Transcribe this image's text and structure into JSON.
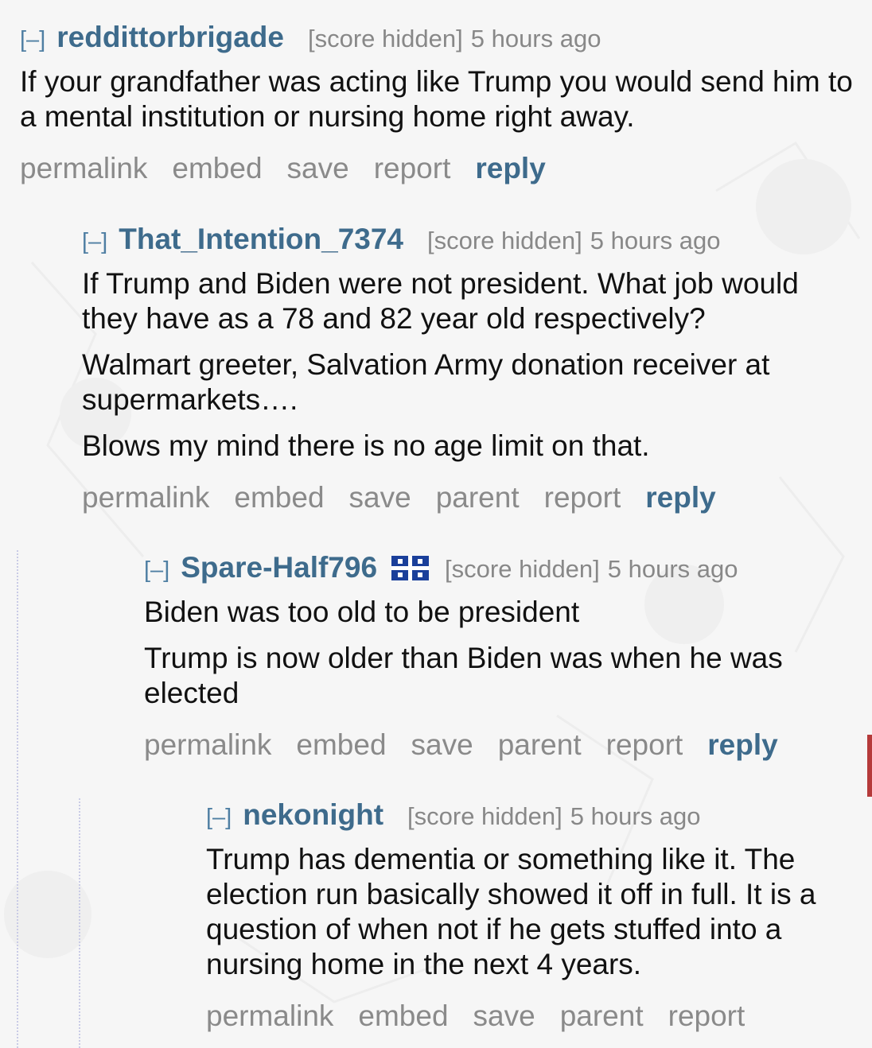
{
  "comments": [
    {
      "collapse": "[–]",
      "author": "reddittorbrigade",
      "score": "[score hidden]",
      "time": "5 hours ago",
      "paragraphs": [
        "If your grandfather was acting like Trump you would send him to a mental institution or nursing home right away."
      ],
      "buttons": {
        "permalink": "permalink",
        "embed": "embed",
        "save": "save",
        "report": "report",
        "reply": "reply"
      }
    },
    {
      "collapse": "[–]",
      "author": "That_Intention_7374",
      "score": "[score hidden]",
      "time": "5 hours ago",
      "paragraphs": [
        "If Trump and Biden were not president. What job would they have as a 78 and 82 year old respectively?",
        "Walmart greeter, Salvation Army donation receiver at supermarkets….",
        "Blows my mind there is no age limit on that."
      ],
      "buttons": {
        "permalink": "permalink",
        "embed": "embed",
        "save": "save",
        "parent": "parent",
        "report": "report",
        "reply": "reply"
      }
    },
    {
      "collapse": "[–]",
      "author": "Spare-Half796",
      "flair_icon": "quebec-flag-icon",
      "score": "[score hidden]",
      "time": "5 hours ago",
      "paragraphs": [
        "Biden was too old to be president",
        "Trump is now older than Biden was when he was elected"
      ],
      "buttons": {
        "permalink": "permalink",
        "embed": "embed",
        "save": "save",
        "parent": "parent",
        "report": "report",
        "reply": "reply"
      }
    },
    {
      "collapse": "[–]",
      "author": "nekonight",
      "score": "[score hidden]",
      "time": "5 hours ago",
      "paragraphs": [
        "Trump has dementia or something like it. The election run basically showed it off in full. It is a question of when not if he gets stuffed into a nursing home in the next 4 years."
      ],
      "buttons": {
        "permalink": "permalink",
        "embed": "embed",
        "save": "save",
        "parent": "parent",
        "report": "report"
      }
    }
  ],
  "colors": {
    "author": "#3e6b8c",
    "muted": "#888888",
    "collapse": "#4f7fa3",
    "flag_blue": "#1a3f9a",
    "edge_marker": "#b53a3a"
  }
}
